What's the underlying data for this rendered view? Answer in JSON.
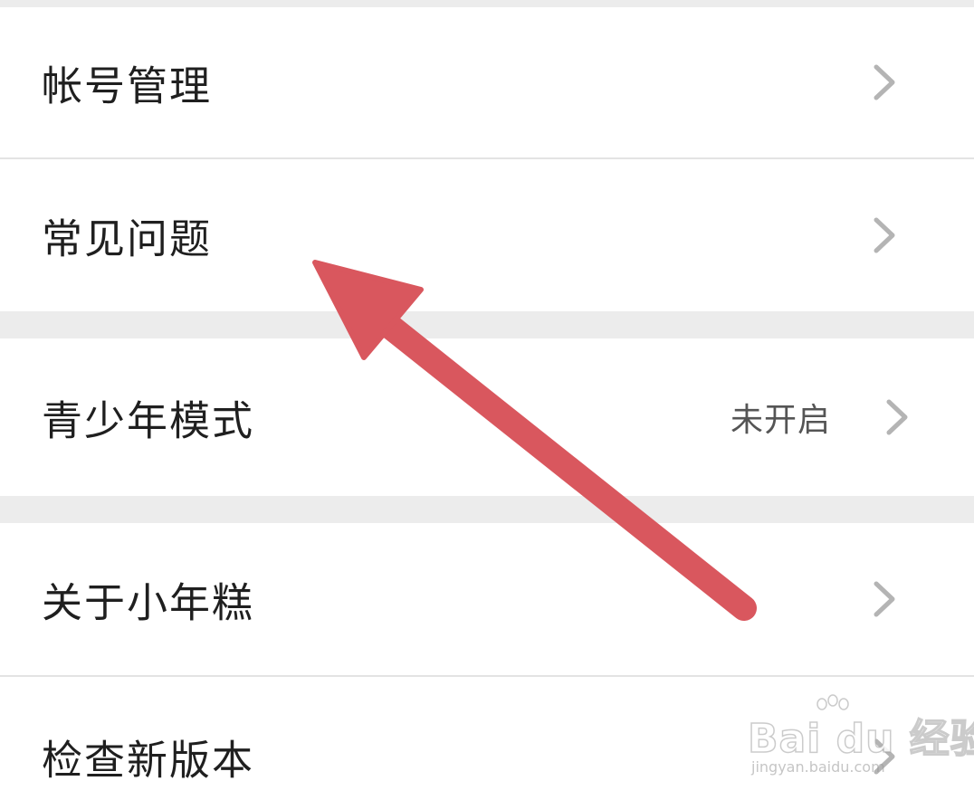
{
  "settings": {
    "items": [
      {
        "label": "帐号管理",
        "value": ""
      },
      {
        "label": "常见问题",
        "value": ""
      },
      {
        "label": "青少年模式",
        "value": "未开启"
      },
      {
        "label": "关于小年糕",
        "value": ""
      },
      {
        "label": "检查新版本",
        "value": ""
      }
    ]
  },
  "annotation": {
    "arrow_color": "#d9575e"
  },
  "watermark": {
    "logo": "Bai du 经验",
    "url": "jingyan.baidu.com"
  },
  "colors": {
    "background": "#ffffff",
    "section_gap": "#ececec",
    "divider": "#e3e3e3",
    "label_text": "#1f1f1f",
    "value_text": "#555555",
    "chevron": "#b4b4b4"
  },
  "icons": {
    "row_chevron": "chevron-right-icon",
    "watermark_paw": "paw-icon"
  }
}
